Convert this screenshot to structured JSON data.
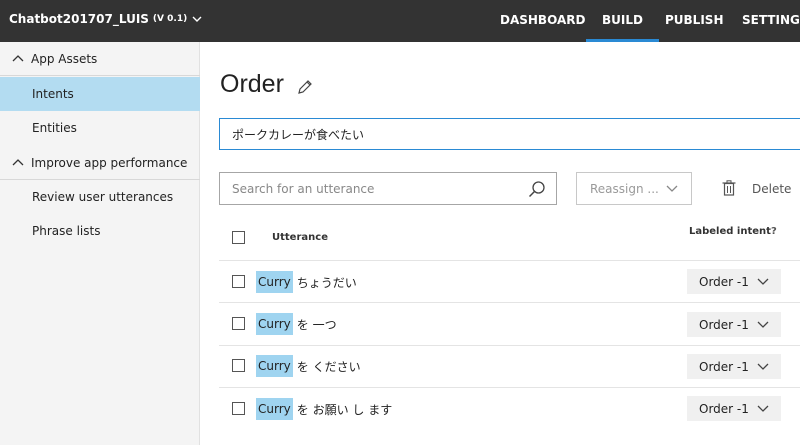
{
  "app": {
    "name": "Chatbot201707_LUIS",
    "version": "(V 0.1)"
  },
  "nav": [
    {
      "label": "DASHBOARD"
    },
    {
      "label": "BUILD"
    },
    {
      "label": "PUBLISH"
    },
    {
      "label": "SETTINGS"
    }
  ],
  "sidebar": {
    "sections": [
      {
        "label": "App Assets"
      },
      {
        "label": "Improve app performance"
      }
    ],
    "items": [
      {
        "label": "Intents"
      },
      {
        "label": "Entities"
      },
      {
        "label": "Review user utterances"
      },
      {
        "label": "Phrase lists"
      }
    ]
  },
  "page": {
    "title": "Order",
    "utterance_input_value": "ポークカレーが食べたい",
    "search_placeholder": "Search for an utterance",
    "reassign_label": "Reassign ...",
    "delete_label": "Delete"
  },
  "table": {
    "header_utterance": "Utterance",
    "header_intent": "Labeled intent",
    "header_help": "?",
    "rows": [
      {
        "entity": "Curry",
        "text": "ちょうだい",
        "intent": "Order -1"
      },
      {
        "entity": "Curry",
        "text": "を 一つ",
        "intent": "Order -1"
      },
      {
        "entity": "Curry",
        "text": "を ください",
        "intent": "Order -1"
      },
      {
        "entity": "Curry",
        "text": "を お願い し ます",
        "intent": "Order -1"
      }
    ]
  },
  "colors": {
    "topbar": "#333333",
    "accent": "#2a8ad4",
    "sidebar_active": "#b3dcf1",
    "entity_highlight": "#9fd4f0"
  }
}
